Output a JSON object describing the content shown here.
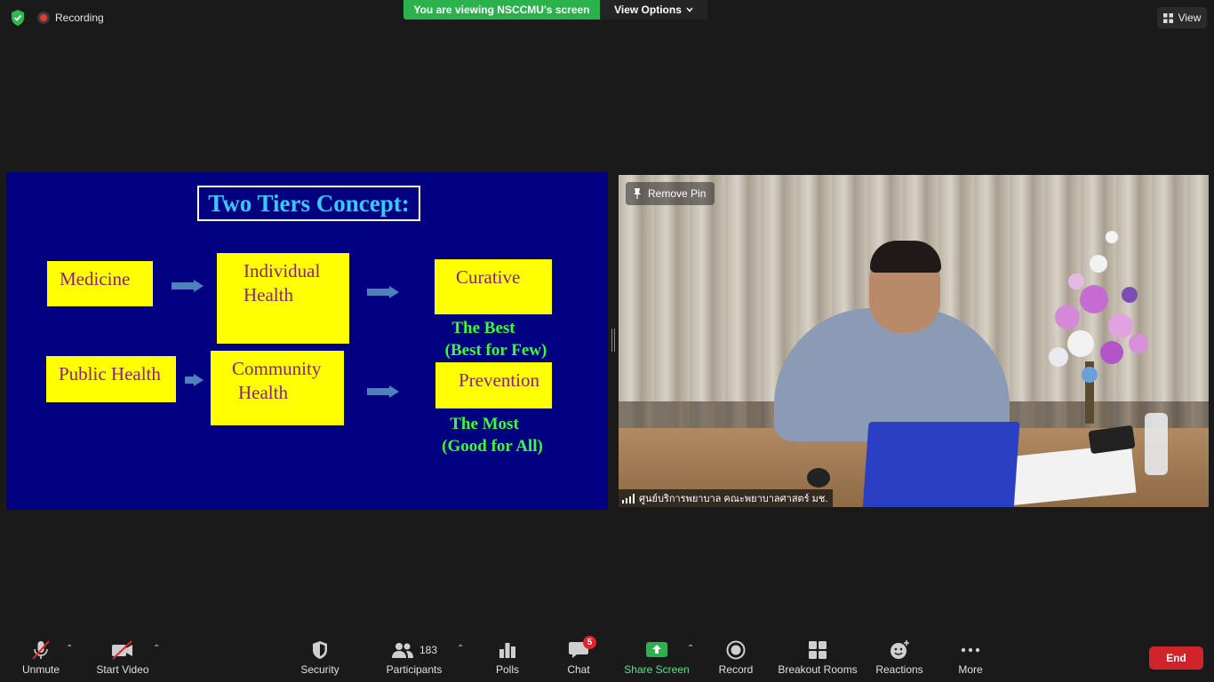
{
  "topbar": {
    "recording_label": "Recording",
    "viewing_banner": "You are viewing NSCCMU's screen",
    "view_options_label": "View Options",
    "view_button_label": "View"
  },
  "slide": {
    "title": "Two Tiers Concept:",
    "boxes": {
      "medicine": "Medicine",
      "individual_health_1": "Individual",
      "individual_health_2": "Health",
      "curative": "Curative",
      "public_health": "Public Health",
      "community_health_1": "Community",
      "community_health_2": "Health",
      "prevention": "Prevention"
    },
    "notes": {
      "best_1": "The Best",
      "best_2": "(Best for Few)",
      "most_1": "The Most",
      "most_2": "(Good for All)"
    },
    "colors": {
      "background": "#000080",
      "box": "#ffff00",
      "box_text": "#8b2080",
      "title": "#33ccff",
      "note": "#33ff33",
      "arrow": "#4f81bd"
    }
  },
  "video": {
    "remove_pin_label": "Remove Pin",
    "participant_name": "ศูนย์บริการพยาบาล คณะพยาบาลศาสตร์ มช."
  },
  "toolbar": {
    "unmute": "Unmute",
    "start_video": "Start Video",
    "security": "Security",
    "participants": "Participants",
    "participants_count": "183",
    "polls": "Polls",
    "chat": "Chat",
    "chat_badge": "5",
    "share_screen": "Share Screen",
    "record": "Record",
    "breakout_rooms": "Breakout Rooms",
    "reactions": "Reactions",
    "more": "More",
    "end": "End"
  }
}
